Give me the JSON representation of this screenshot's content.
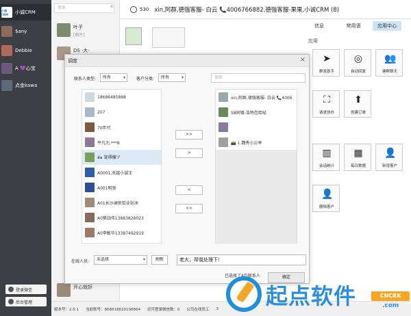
{
  "sidebar": {
    "items": [
      {
        "label": "小诚CRM",
        "avatar_label": "小诚CRM",
        "color": "#ffffff"
      },
      {
        "label": "$any",
        "color": "#8a6d5a"
      },
      {
        "label": "Debbie",
        "color": "#b06a5c"
      },
      {
        "label": "A 💜心宝",
        "color": "#6c5a7a"
      },
      {
        "label": "点金kawa",
        "color": "#5c6a7c"
      }
    ],
    "footer_buttons": [
      "登录微信",
      "后台管理"
    ]
  },
  "middle": {
    "search_placeholder": "搜索",
    "rows": [
      {
        "name": "叶子",
        "sub": "[图片]"
      },
      {
        "name": "DS ·大·",
        "sub": ""
      },
      {
        "name": "开心就好",
        "sub": ""
      }
    ]
  },
  "header": {
    "count": "530",
    "title": "xin,阿群,德强客服- 白云 📞4006766882,德强客服-果果,小诚CRM (8)"
  },
  "right_panel": {
    "tabs": [
      "信息",
      "常用语",
      "应用中心"
    ],
    "active_tab": "应用中心",
    "section": "应用",
    "apps": [
      {
        "label": "群发助手",
        "icon": "send-icon"
      },
      {
        "label": "自动回复",
        "icon": "robot-icon"
      },
      {
        "label": "建群聊天",
        "icon": "group-icon"
      },
      {
        "label": "请求协办",
        "icon": "assist-icon"
      },
      {
        "label": "创建订单",
        "icon": "upload-icon"
      },
      {
        "label": "会话统计",
        "icon": "stats-icon"
      },
      {
        "label": "每日数据",
        "icon": "calendar-icon"
      },
      {
        "label": "新增客户",
        "icon": "add-user-icon"
      },
      {
        "label": "删除客户",
        "icon": "remove-user-icon"
      }
    ]
  },
  "dialog": {
    "title": "调度",
    "contact_type_label": "联系人类型:",
    "contact_type_value": "所有",
    "customer_category_label": "客户分类:",
    "customer_category_value": "所有",
    "search_placeholder": "搜索",
    "left_list": [
      {
        "label": "18686485888",
        "color": "#cfd8dc"
      },
      {
        "label": "207",
        "color": "#a8b8c8"
      },
      {
        "label": "70年代",
        "color": "#7a5a3c"
      },
      {
        "label": "平凡力,***8",
        "color": "#8c7a9a"
      },
      {
        "label": "๑ั๑ 宠得横ヅ",
        "color": "#7aa05a"
      },
      {
        "label": "A0001,天越小诚王",
        "color": "#2c5ea8"
      },
      {
        "label": "A001明渐",
        "color": "#2a4f9a"
      },
      {
        "label": "A01长沙澜依铝业张洲",
        "color": "#a08a78"
      },
      {
        "label": "A0樊战伟13883828023",
        "color": "#8a6a5a"
      },
      {
        "label": "A0李敏华13387492919",
        "color": "#9a7a68"
      }
    ],
    "selected_left_index": 4,
    "right_list": [
      {
        "label": "xin,阿群,德强客服- 白云 📞4006",
        "color": "#9aa8b0"
      },
      {
        "label": "58同镇-浩特芭哈哒",
        "color": "#6a8a5a"
      },
      {
        "label": "",
        "color": "#8a7aa0"
      },
      {
        "label": "📸 ⒈魏秀小公举",
        "color": "#a0a0a0"
      }
    ],
    "buttons": {
      "add_all": ">>",
      "add": ">",
      "remove": "<",
      "remove_all": "<<"
    },
    "online_label": "在线人员:",
    "online_value": "未选择",
    "refresh_label": "刷新",
    "message": "老大，帮我处理下！",
    "confirm_text": "已选择了4位联系人",
    "ok_label": "确定"
  },
  "status_bar": {
    "version": "版本号：2.5.1",
    "account": "当前账号：868618620198864",
    "login_count": "还可登录微信数：0",
    "online": "公司在线员工",
    "online_count": "3"
  },
  "watermark": {
    "text": "起点软件",
    "badge": "CNCRK",
    "domain": ".com"
  }
}
